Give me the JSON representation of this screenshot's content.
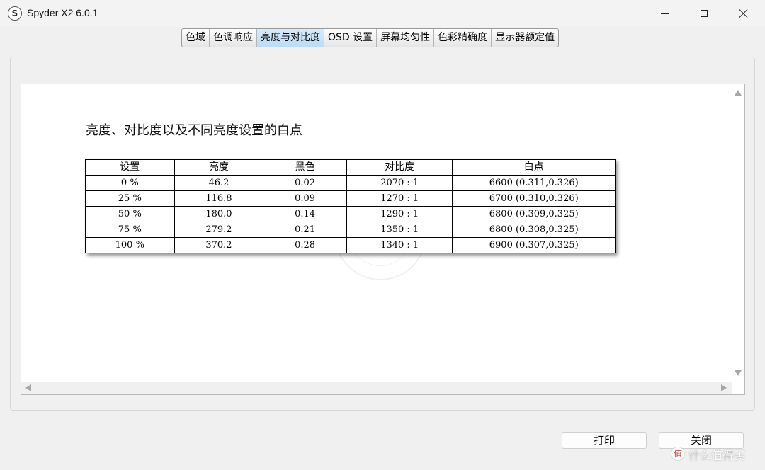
{
  "window": {
    "app_icon_letter": "S",
    "title": "Spyder X2 6.0.1"
  },
  "tabs": [
    {
      "label": "色域",
      "active": false
    },
    {
      "label": "色调响应",
      "active": false
    },
    {
      "label": "亮度与对比度",
      "active": true
    },
    {
      "label": "OSD 设置",
      "active": false
    },
    {
      "label": "屏幕均匀性",
      "active": false
    },
    {
      "label": "色彩精确度",
      "active": false
    },
    {
      "label": "显示器额定值",
      "active": false
    }
  ],
  "zoom": {
    "icons": [
      "zoom-in-icon",
      "zoom-out-icon",
      "zoom-fit-icon"
    ]
  },
  "report": {
    "title": "亮度、对比度以及不同亮度设置的白点",
    "table": {
      "headers": [
        "设置",
        "亮度",
        "黑色",
        "对比度",
        "白点"
      ],
      "rows": [
        [
          "0 %",
          "46.2",
          "0.02",
          "2070 : 1",
          "6600 (0.311,0.326)"
        ],
        [
          "25 %",
          "116.8",
          "0.09",
          "1270 : 1",
          "6700 (0.310,0.326)"
        ],
        [
          "50 %",
          "180.0",
          "0.14",
          "1290 : 1",
          "6800 (0.309,0.325)"
        ],
        [
          "75 %",
          "279.2",
          "0.21",
          "1350 : 1",
          "6800 (0.308,0.325)"
        ],
        [
          "100 %",
          "370.2",
          "0.28",
          "1340 : 1",
          "6900 (0.307,0.325)"
        ]
      ]
    }
  },
  "buttons": {
    "print": "打印",
    "close": "关闭"
  },
  "watermark": {
    "logo": "值",
    "text": "什么值得买"
  },
  "colors": {
    "active_tab": "#b9dcf6",
    "background": "#f0f0f0"
  }
}
